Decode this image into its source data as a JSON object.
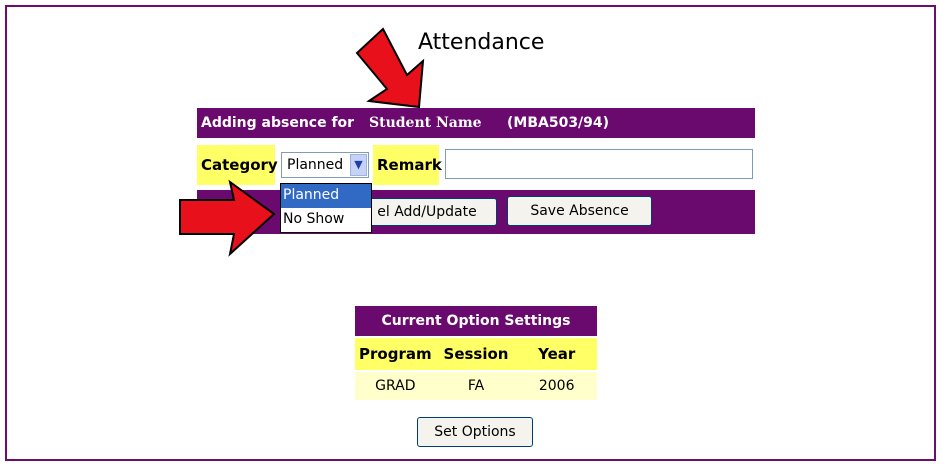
{
  "page": {
    "title": "Attendance"
  },
  "absence_header": {
    "adding_label": "Adding absence for",
    "student_name": "Student Name",
    "student_id": "(MBA503/94)"
  },
  "form": {
    "category_label": "Category",
    "category_selected": "Planned",
    "remark_label": "Remark",
    "remark_value": ""
  },
  "dropdown": {
    "options": [
      "Planned",
      "No Show"
    ],
    "highlighted": "Planned"
  },
  "buttons": {
    "cancel_label": "Cancel Add/Update",
    "cancel_visible_label": "el Add/Update",
    "save_label": "Save Absence",
    "set_options_label": "Set Options"
  },
  "options_table": {
    "title": "Current Option Settings",
    "columns": [
      "Program",
      "Session",
      "Year"
    ],
    "values": [
      "GRAD",
      "FA",
      "2006"
    ]
  },
  "colors": {
    "header_purple": "#6a0a6e",
    "label_yellow": "#ffff66",
    "value_cream": "#ffffcc",
    "arrow_red": "#e8101a"
  }
}
